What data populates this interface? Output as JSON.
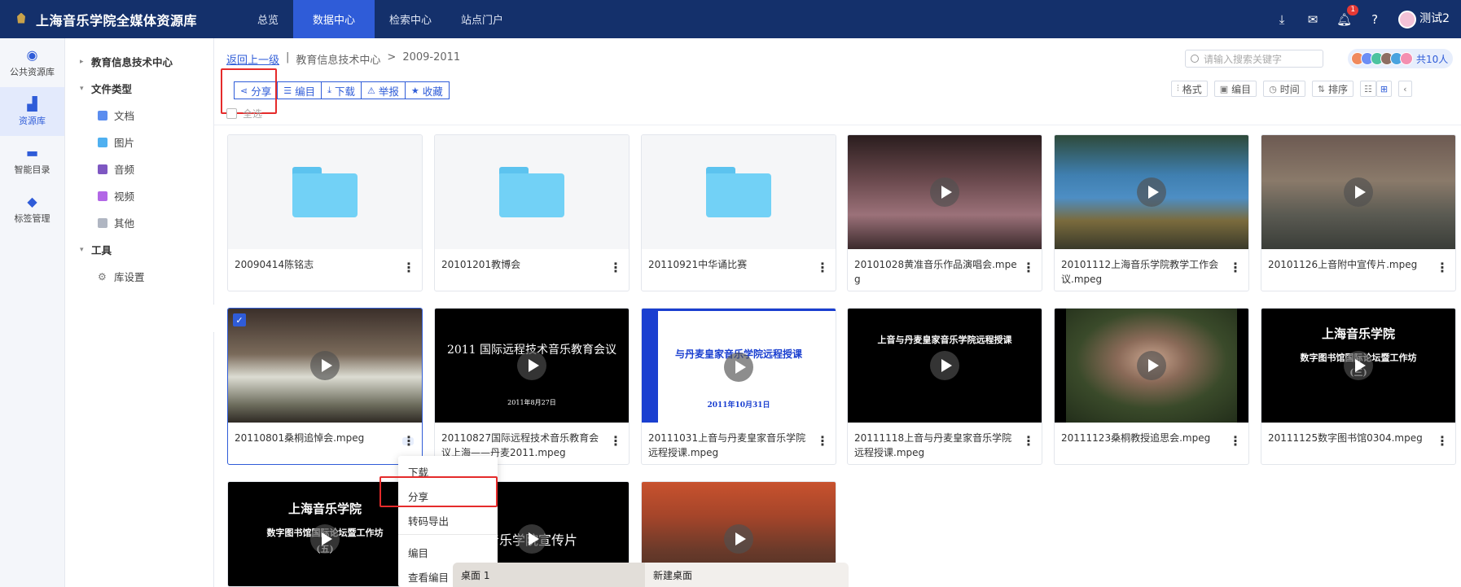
{
  "app": {
    "title": "上海音乐学院全媒体资源库",
    "nav": [
      "总览",
      "数据中心",
      "检索中心",
      "站点门户"
    ],
    "active_nav": "数据中心",
    "notification_count": "1",
    "user_name": "测试2"
  },
  "rail": [
    "公共资源库",
    "资源库",
    "智能目录",
    "标签管理"
  ],
  "tree": {
    "root": "教育信息技术中心",
    "file_types_label": "文件类型",
    "file_types": [
      "文档",
      "图片",
      "音频",
      "视频",
      "其他"
    ],
    "tools_label": "工具",
    "tools": [
      "库设置"
    ]
  },
  "breadcrumb": {
    "back": "返回上一级",
    "sep1": "|",
    "parent": "教育信息技术中心",
    "sep2": ">",
    "current": "2009-2011"
  },
  "search": {
    "placeholder": "请输入搜索关键字"
  },
  "members": {
    "label": "共10人"
  },
  "toolbar": [
    "分享",
    "编目",
    "下载",
    "举报",
    "收藏"
  ],
  "select_all": "全选",
  "right_tools": [
    "格式",
    "编目",
    "时间",
    "排序"
  ],
  "files": [
    {
      "name": "20090414陈铭志",
      "type": "folder"
    },
    {
      "name": "20101201教博会",
      "type": "folder"
    },
    {
      "name": "20110921中华诵比赛",
      "type": "folder"
    },
    {
      "name": "20101028黄准音乐作品演唱会.mpeg",
      "type": "video"
    },
    {
      "name": "20101112上海音乐学院教学工作会议.mpeg",
      "type": "video"
    },
    {
      "name": "20101126上音附中宣传片.mpeg",
      "type": "video"
    },
    {
      "name": "20110801桑桐追悼会.mpeg",
      "type": "video",
      "selected": true
    },
    {
      "name": "20110827国际远程技术音乐教育会议上海——丹麦2011.mpeg",
      "type": "video",
      "thumb_text": "2011 国际远程技术音乐教育会议",
      "thumb_sub": "2011年8月27日"
    },
    {
      "name": "20111031上音与丹麦皇家音乐学院远程授课.mpeg",
      "type": "video",
      "thumb_text": "与丹麦皇家音乐学院远程授课",
      "thumb_sub": "2011年10月31日"
    },
    {
      "name": "20111118上音与丹麦皇家音乐学院远程授课.mpeg",
      "type": "video",
      "thumb_text": "上音与丹麦皇家音乐学院远程授课"
    },
    {
      "name": "20111123桑桐教授追思会.mpeg",
      "type": "video"
    },
    {
      "name": "20111125数字图书馆0304.mpeg",
      "type": "video",
      "thumb_text": "上海音乐学院",
      "thumb_sub": "数字图书馆国际论坛暨工作坊",
      "thumb_sub2": "(三)"
    },
    {
      "name": "",
      "type": "video",
      "thumb_text": "上海音乐学院",
      "thumb_sub": "数字图书馆国际论坛暨工作坊",
      "thumb_sub2": "(五)"
    },
    {
      "name": "",
      "type": "video",
      "thumb_text": "音乐学院宣传片"
    },
    {
      "name": "",
      "type": "video"
    }
  ],
  "context_menu": [
    "下载",
    "分享",
    "转码导出",
    "编目",
    "查看编目"
  ],
  "taskbar": [
    "桌面 1",
    "新建桌面"
  ],
  "colors": {
    "nav_bg": "#14306b",
    "accent": "#2f5cd8",
    "highlight": "#e52b2b"
  }
}
